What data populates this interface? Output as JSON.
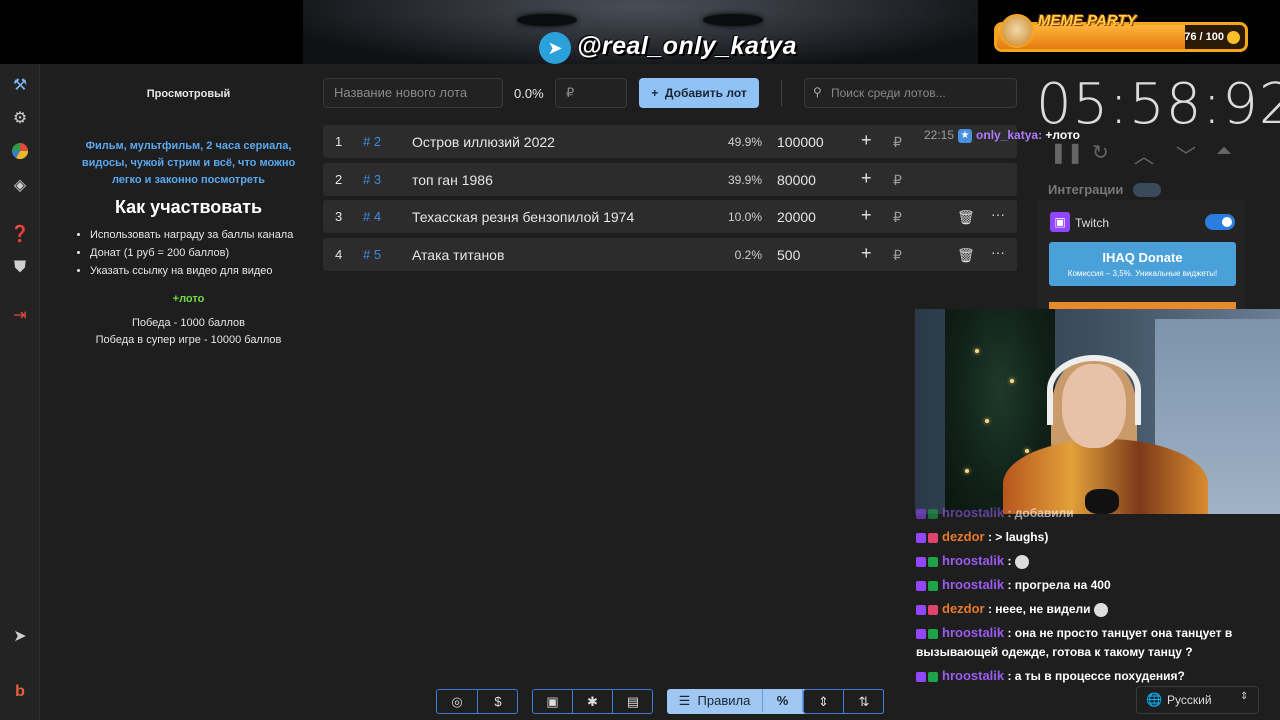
{
  "banner": {
    "handle": "@real_only_katya",
    "meme_party": {
      "label": "MEME PARTY",
      "counter": "76 / 100",
      "progress": 0.76
    }
  },
  "sidebar": {
    "icons": [
      "auction-icon",
      "gear-icon",
      "pie-chart-icon",
      "layers-icon",
      "help-icon",
      "shield-icon",
      "logout-icon",
      "telegram-icon",
      "b-logo-icon",
      "eye-icon"
    ]
  },
  "description": {
    "title": "Просмотровый",
    "blue_text": "Фильм, мультфильм, 2 часа сериала, видосы, чужой стрим и всё, что можно легко и законно посмотреть",
    "heading": "Как участвовать",
    "bullets": [
      "Использовать награду за баллы канала",
      "Донат (1 руб = 200 баллов)",
      "Указать ссылку на видео для видео"
    ],
    "plus": "+лото",
    "win1": "Победа - 1000 баллов",
    "win2": "Победа в супер игре - 10000 баллов"
  },
  "toolbar": {
    "lot_name_placeholder": "Название нового лота",
    "percent": "0.0%",
    "amount_placeholder": "₽",
    "add_button": "Добавить лот",
    "search_placeholder": "Поиск среди лотов..."
  },
  "lots": [
    {
      "num": "1",
      "id": "# 2",
      "name": "Остров иллюзий 2022",
      "percent": "49.9%",
      "value": "100000"
    },
    {
      "num": "2",
      "id": "# 3",
      "name": "топ ган 1986",
      "percent": "39.9%",
      "value": "80000"
    },
    {
      "num": "3",
      "id": "# 4",
      "name": "Техасская резня бензопилой 1974",
      "percent": "10.0%",
      "value": "20000"
    },
    {
      "num": "4",
      "id": "# 5",
      "name": "Атака титанов",
      "percent": "0.2%",
      "value": "500"
    }
  ],
  "row_symbols": {
    "plus": "+",
    "rub": "₽",
    "delete": "🗑",
    "more": "···"
  },
  "overlay_chat": {
    "time": "22:15",
    "user": "only_katya:",
    "message": "+лото"
  },
  "timer": {
    "value": "05:58:92"
  },
  "integrations": {
    "label": "Интеграции",
    "twitch": "Twitch",
    "donate_title": "IHAQ Donate",
    "donate_sub": "Комиссия – 3,5%. Уникальные виджеты!"
  },
  "chat": [
    {
      "user": "hroostalik",
      "text": ": добавили",
      "badge": "green"
    },
    {
      "user": "dezdor",
      "text": ": > laughs)",
      "badge": "pink"
    },
    {
      "user": "hroostalik",
      "text": ":",
      "badge": "green",
      "emote": true
    },
    {
      "user": "hroostalik",
      "text": ": прогрела на 400",
      "badge": "green"
    },
    {
      "user": "dezdor",
      "text": ": нееe, не видели",
      "badge": "pink",
      "emote": true
    },
    {
      "user": "hroostalik",
      "text": ": она не просто танцует она танцует в вызывающей одежде, готова к такому танцу ?",
      "badge": "green"
    },
    {
      "user": "hroostalik",
      "text": ": а ты в процессе похудения?",
      "badge": "green"
    }
  ],
  "bottom": {
    "rules": "Правила",
    "percent_sym": "%",
    "language": "Русский"
  },
  "colors": {
    "accent": "#90c2f5",
    "twitch": "#9146ff",
    "id_blue": "#3d8be0",
    "green": "#6fdc4a"
  }
}
